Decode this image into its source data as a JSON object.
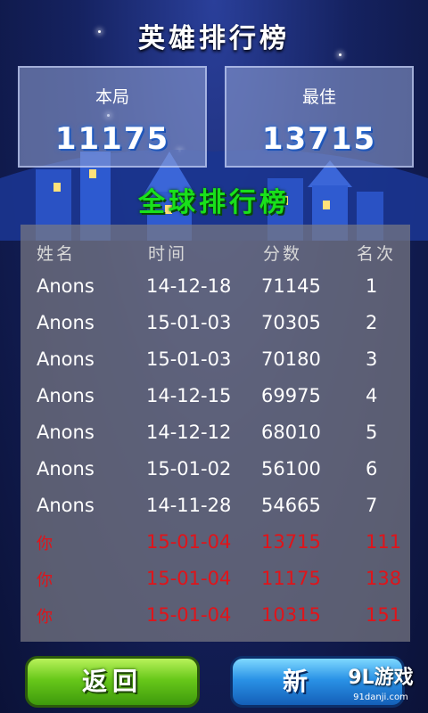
{
  "title": "英雄排行榜",
  "scores": {
    "current": {
      "label": "本局",
      "value": "11175"
    },
    "best": {
      "label": "最佳",
      "value": "13715"
    }
  },
  "global_title": "全球排行榜",
  "table": {
    "headers": [
      "姓名",
      "时间",
      "分数",
      "名次"
    ],
    "rows": [
      {
        "name": "Anons",
        "date": "14-12-18",
        "score": "71145",
        "rank": "1",
        "is_self": false
      },
      {
        "name": "Anons",
        "date": "15-01-03",
        "score": "70305",
        "rank": "2",
        "is_self": false
      },
      {
        "name": "Anons",
        "date": "15-01-03",
        "score": "70180",
        "rank": "3",
        "is_self": false
      },
      {
        "name": "Anons",
        "date": "14-12-15",
        "score": "69975",
        "rank": "4",
        "is_self": false
      },
      {
        "name": "Anons",
        "date": "14-12-12",
        "score": "68010",
        "rank": "5",
        "is_self": false
      },
      {
        "name": "Anons",
        "date": "15-01-02",
        "score": "56100",
        "rank": "6",
        "is_self": false
      },
      {
        "name": "Anons",
        "date": "14-11-28",
        "score": "54665",
        "rank": "7",
        "is_self": false
      },
      {
        "name": "你",
        "date": "15-01-04",
        "score": "13715",
        "rank": "111",
        "is_self": true
      },
      {
        "name": "你",
        "date": "15-01-04",
        "score": "11175",
        "rank": "138",
        "is_self": true
      },
      {
        "name": "你",
        "date": "15-01-04",
        "score": "10315",
        "rank": "151",
        "is_self": true
      }
    ]
  },
  "buttons": {
    "back_label": "返回",
    "new_label": "新"
  },
  "watermark": {
    "main": "9L游戏",
    "sub": "91danji.com"
  },
  "colors": {
    "self_row": "#e0141a",
    "global_title": "#19e11b",
    "score_glow": "#2a6fd8"
  }
}
